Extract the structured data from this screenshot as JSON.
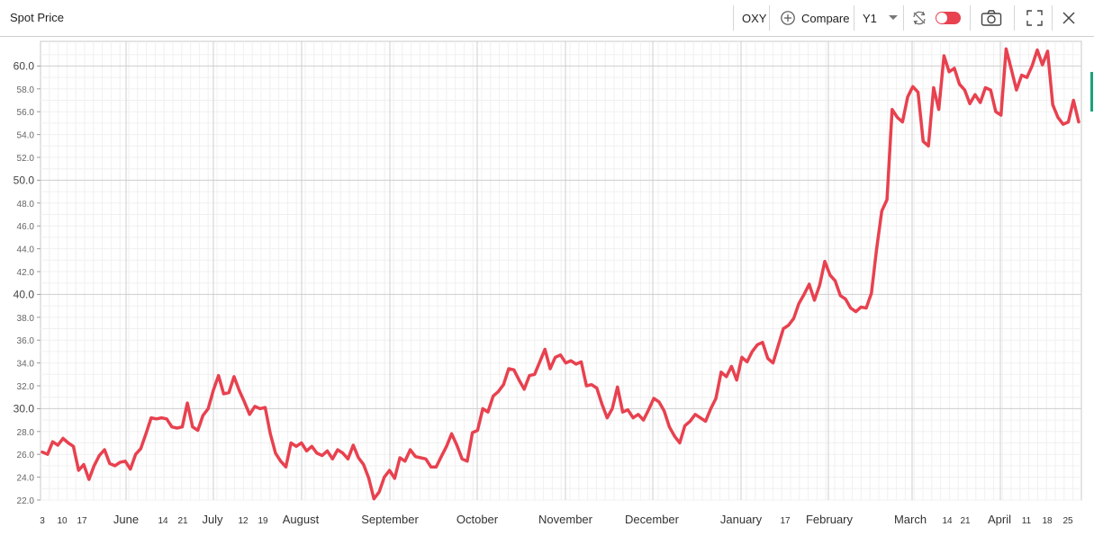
{
  "header": {
    "title": "Spot Price",
    "ticker": "OXY",
    "compare_label": "Compare",
    "period": "Y1"
  },
  "chart_data": {
    "type": "line",
    "title": "Spot Price",
    "xlabel": "",
    "ylabel": "",
    "ylim": [
      22,
      61.5
    ],
    "y_ticks": [
      "22.0",
      "24.0",
      "26.0",
      "28.0",
      "30.0",
      "32.0",
      "34.0",
      "36.0",
      "38.0",
      "40.0",
      "42.0",
      "44.0",
      "46.0",
      "48.0",
      "50.0",
      "52.0",
      "54.0",
      "56.0",
      "58.0",
      "60.0"
    ],
    "x_ticks": [
      "3",
      "10",
      "17",
      "June",
      "14",
      "21",
      "July",
      "12",
      "19",
      "August",
      "September",
      "October",
      "November",
      "December",
      "January",
      "17",
      "February",
      "March",
      "14",
      "21",
      "April",
      "11",
      "18",
      "25"
    ],
    "grid": true,
    "line_color": "#e8414f",
    "series": [
      {
        "values": [
          26.2,
          26.0,
          27.1,
          26.8,
          27.4,
          27.0,
          26.7,
          24.6,
          25.1,
          23.8,
          25.0,
          25.9,
          26.4,
          25.2,
          25.0,
          25.3,
          25.4,
          24.7,
          26.0,
          26.5,
          27.8,
          29.2,
          29.1,
          29.2,
          29.1,
          28.4,
          28.3,
          28.4,
          30.5,
          28.4,
          28.1,
          29.4,
          30.0,
          31.6,
          32.9,
          31.3,
          31.4,
          32.8,
          31.6,
          30.6,
          29.5,
          30.2,
          30.0,
          30.1,
          27.8,
          26.1,
          25.4,
          24.9,
          27.0,
          26.7,
          27.0,
          26.3,
          26.7,
          26.1,
          25.9,
          26.3,
          25.6,
          26.4,
          26.1,
          25.6,
          26.8,
          25.7,
          25.1,
          23.9,
          22.1,
          22.7,
          24.0,
          24.6,
          23.9,
          25.7,
          25.4,
          26.4,
          25.8,
          25.7,
          25.6,
          24.9,
          24.9,
          25.8,
          26.7,
          27.8,
          26.8,
          25.6,
          25.4,
          27.9,
          28.1,
          30.0,
          29.7,
          31.1,
          31.5,
          32.1,
          33.5,
          33.4,
          32.5,
          31.7,
          32.9,
          33.0,
          34.1,
          35.2,
          33.5,
          34.5,
          34.7,
          34.0,
          34.2,
          33.9,
          34.1,
          32.0,
          32.1,
          31.8,
          30.4,
          29.2,
          30.0,
          31.9,
          29.7,
          29.9,
          29.2,
          29.5,
          29.0,
          29.9,
          30.9,
          30.6,
          29.8,
          28.4,
          27.6,
          27.0,
          28.5,
          28.9,
          29.5,
          29.2,
          28.9,
          30.0,
          30.9,
          33.2,
          32.8,
          33.7,
          32.5,
          34.5,
          34.1,
          35.0,
          35.6,
          35.8,
          34.4,
          34.0,
          35.5,
          37.0,
          37.3,
          37.9,
          39.2,
          40.0,
          40.9,
          39.5,
          40.8,
          42.9,
          41.7,
          41.2,
          39.9,
          39.6,
          38.8,
          38.5,
          38.9,
          38.8,
          40.1,
          44.0,
          47.3,
          48.3,
          56.2,
          55.5,
          55.1,
          57.3,
          58.2,
          57.7,
          53.4,
          53.0,
          58.1,
          56.2,
          60.9,
          59.5,
          59.8,
          58.4,
          57.9,
          56.7,
          57.5,
          56.8,
          58.1,
          57.9,
          56.0,
          55.7,
          61.5,
          59.7,
          57.9,
          59.2,
          59.0,
          60.0,
          61.4,
          60.1,
          61.3,
          56.6,
          55.5,
          54.9,
          55.1,
          57.0,
          55.1
        ]
      }
    ]
  }
}
